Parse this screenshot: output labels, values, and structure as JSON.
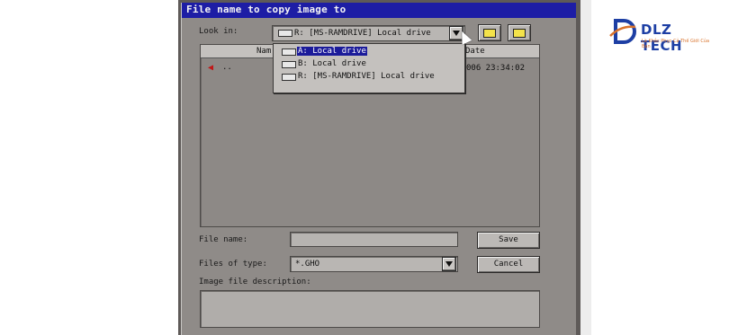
{
  "dialog": {
    "title": "File name to copy image to",
    "look_in_label": "Look in:",
    "look_in_value": "R: [MS-RAMDRIVE] Local drive",
    "dropdown_items": [
      {
        "label": "A: Local drive",
        "selected": true
      },
      {
        "label": "B: Local drive",
        "selected": false
      },
      {
        "label": "R: [MS-RAMDRIVE] Local drive",
        "selected": false
      }
    ],
    "list": {
      "name_header": "Nam",
      "date_header": "Date",
      "row_name": "..",
      "row_date": "006 23:34:02"
    },
    "file_name_label": "File name:",
    "file_name_value": "",
    "files_of_type_label": "Files of type:",
    "files_of_type_value": "*.GHO",
    "image_desc_label": "Image file description:",
    "save_label": "Save",
    "cancel_label": "Cancel"
  },
  "logo": {
    "text": "DLZ TECH",
    "tagline": "Là Khắc Phục Cả Thế Giới Của Bạn"
  },
  "colors": {
    "title_bar": "#1d1da5",
    "dialog_bg": "#8f8b88",
    "selection": "#1b1b9a",
    "logo_blue": "#1d3fa4",
    "logo_orange": "#d9732c"
  }
}
